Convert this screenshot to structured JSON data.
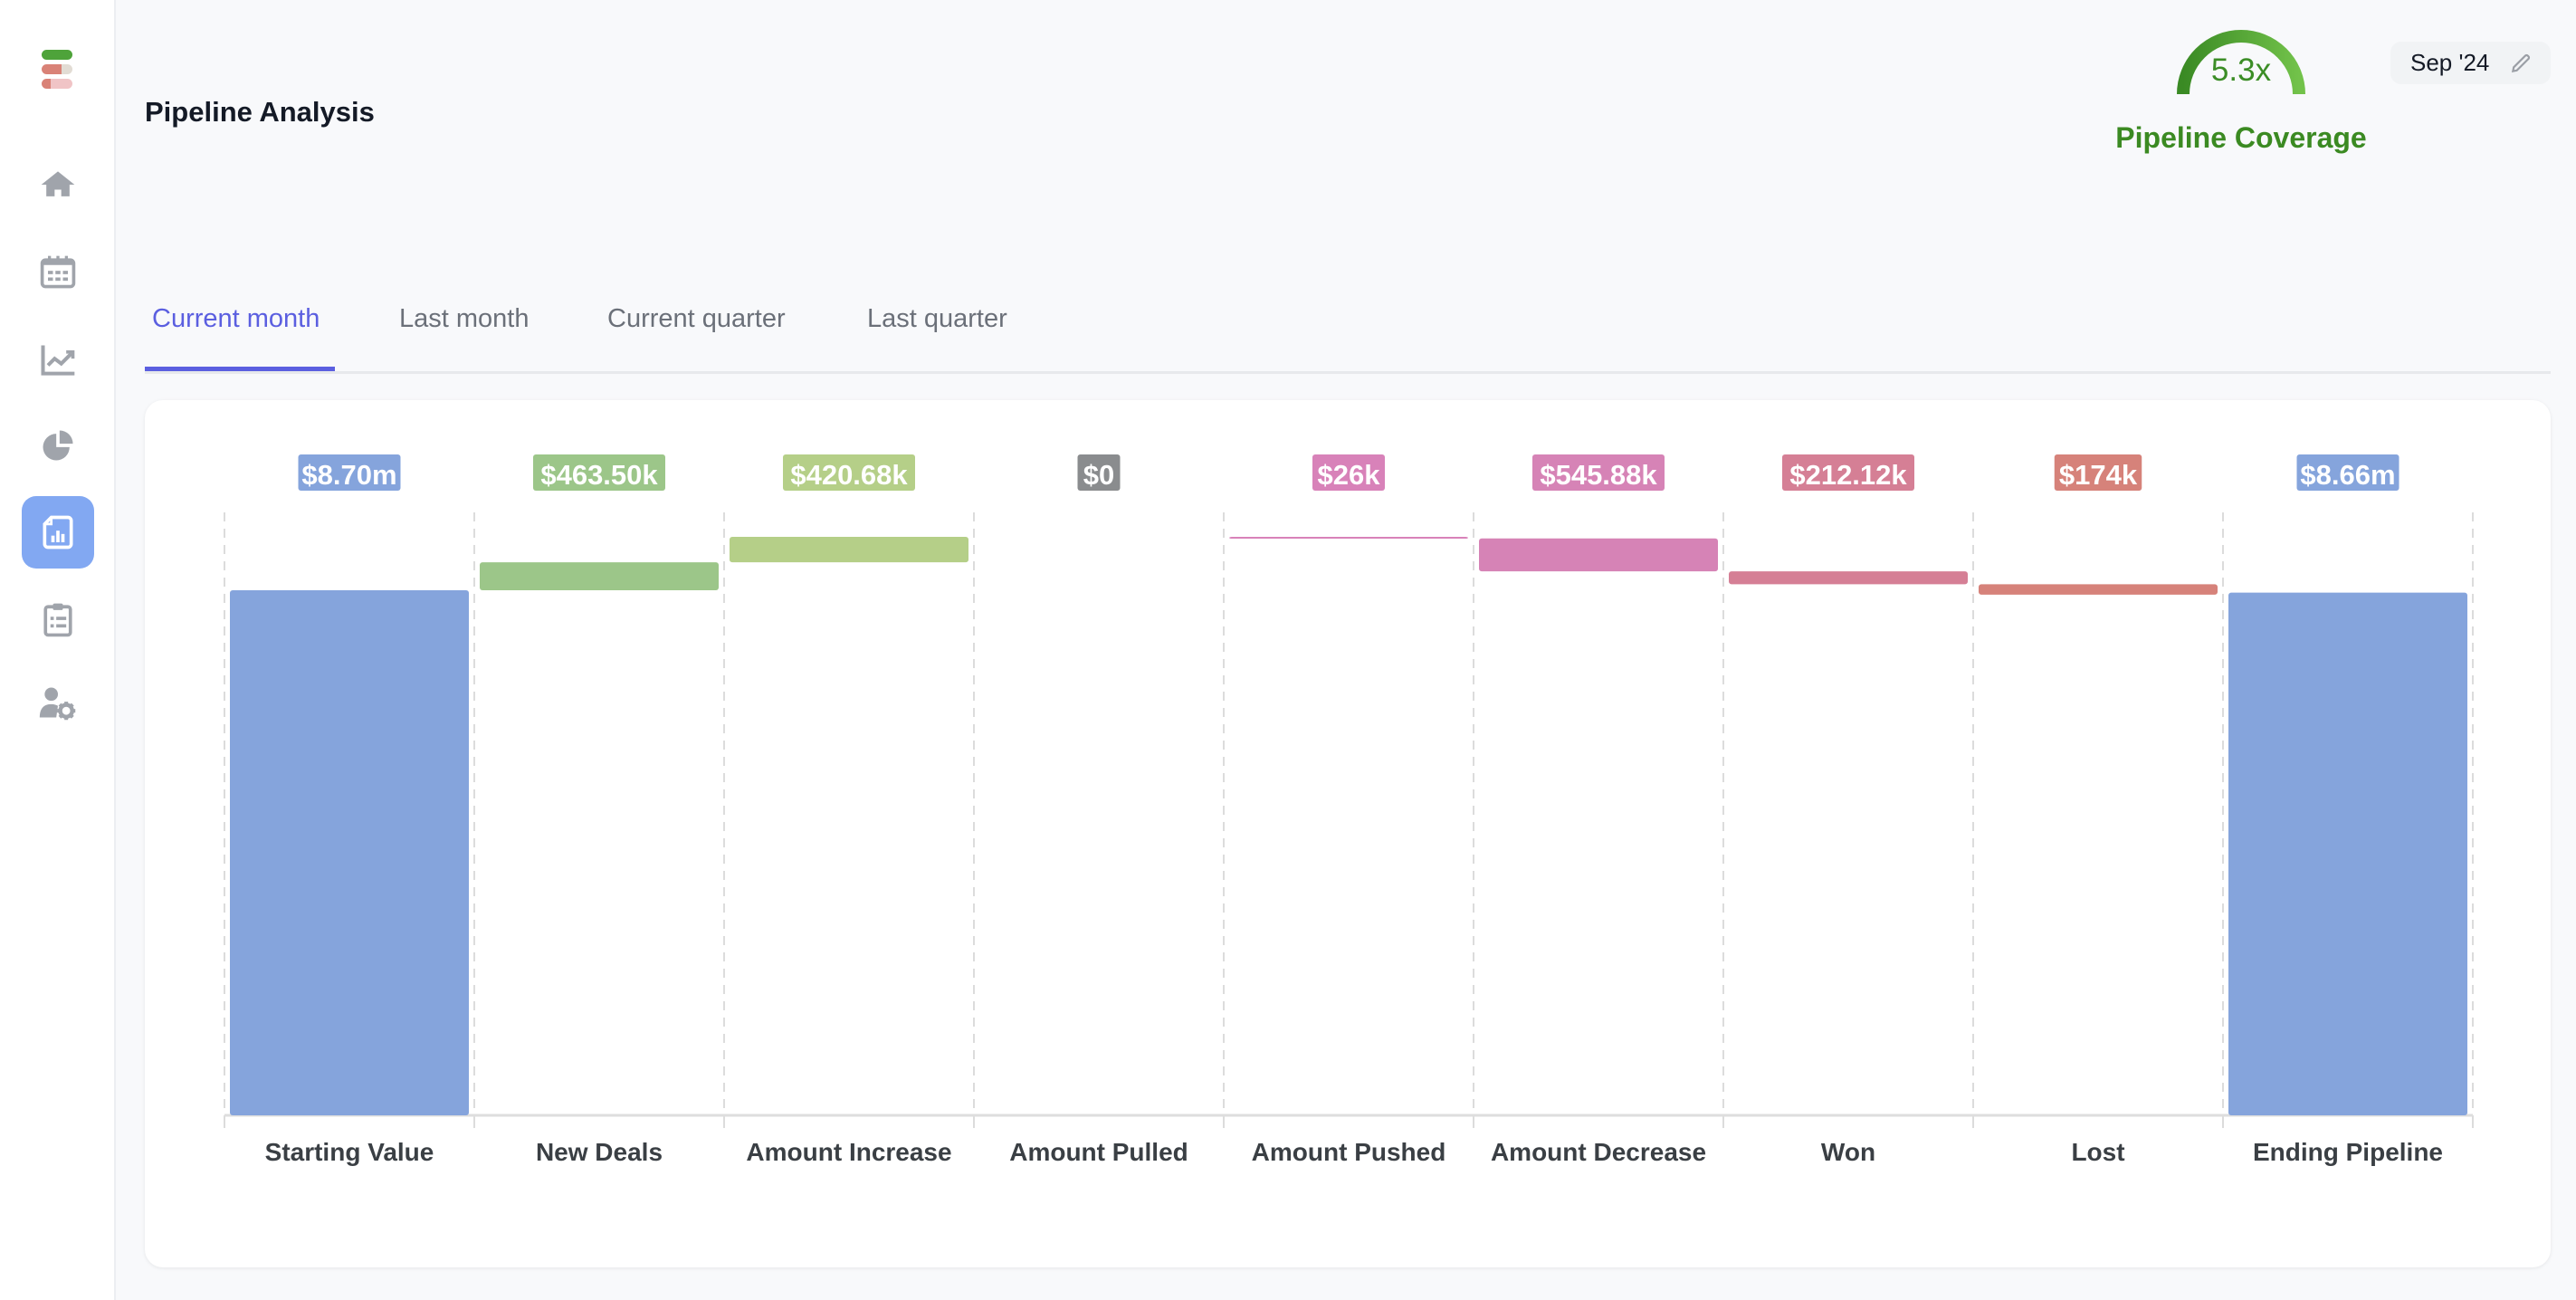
{
  "app": {
    "nav": [
      {
        "name": "home",
        "icon": "home-icon",
        "active": false
      },
      {
        "name": "calendar",
        "icon": "calendar-icon",
        "active": false
      },
      {
        "name": "trends",
        "icon": "line-chart-icon",
        "active": false
      },
      {
        "name": "breakdown",
        "icon": "pie-chart-icon",
        "active": false
      },
      {
        "name": "reports",
        "icon": "report-icon",
        "active": true
      },
      {
        "name": "tasks",
        "icon": "clipboard-icon",
        "active": false
      },
      {
        "name": "user-settings",
        "icon": "user-gear-icon",
        "active": false
      }
    ]
  },
  "header": {
    "title": "Pipeline Analysis",
    "coverage": {
      "value_label": "5.3x",
      "label": "Pipeline Coverage",
      "color": "#3b8a22"
    },
    "date": {
      "label": "Sep '24",
      "icon": "pencil-icon"
    }
  },
  "tabs": [
    {
      "label": "Current month",
      "active": true
    },
    {
      "label": "Last month",
      "active": false
    },
    {
      "label": "Current quarter",
      "active": false
    },
    {
      "label": "Last quarter",
      "active": false
    }
  ],
  "chart_data": {
    "type": "bar",
    "subtype": "waterfall",
    "title": "",
    "xlabel": "",
    "ylabel": "",
    "ylim": [
      0,
      9.3
    ],
    "units": "USD millions",
    "grid": "vertical dashed",
    "legend": "none",
    "categories": [
      "Starting Value",
      "New Deals",
      "Amount Increase",
      "Amount Pulled",
      "Amount Pushed",
      "Amount Decrease",
      "Won",
      "Lost",
      "Ending Pipeline"
    ],
    "values": [
      8.7,
      0.4635,
      0.42068,
      0,
      -0.026,
      -0.54588,
      -0.21212,
      -0.174,
      8.66
    ],
    "kinds": [
      "total",
      "increase",
      "increase",
      "neutral",
      "decrease",
      "decrease",
      "decrease",
      "decrease",
      "total"
    ],
    "data_labels": [
      "$8.70m",
      "$463.50k",
      "$420.68k",
      "$0",
      "$26k",
      "$545.88k",
      "$212.12k",
      "$174k",
      "$8.66m"
    ],
    "colors": [
      "#85a4dc",
      "#9cc689",
      "#b5cf88",
      "#8a8c8e",
      "#d882b9",
      "#d683b6",
      "#d57f95",
      "#d6827a",
      "#85a4dc"
    ]
  }
}
